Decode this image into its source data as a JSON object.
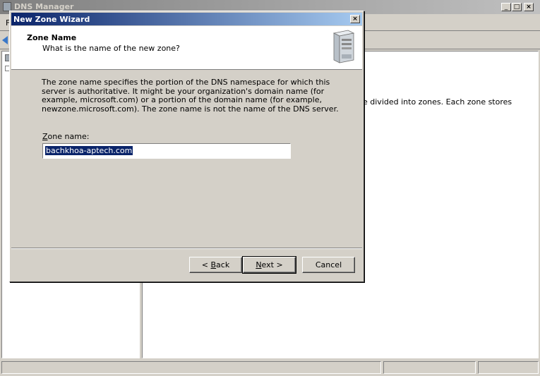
{
  "main_window": {
    "title": "DNS Manager",
    "menu_first_letter": "F",
    "right_pane_text": "e divided into zones. Each zone stores",
    "min_btn": "_",
    "max_btn": "□",
    "close_btn": "×"
  },
  "wizard": {
    "title": "New Zone Wizard",
    "close_btn": "×",
    "header_title": "Zone Name",
    "header_subtitle": "What is the name of the new zone?",
    "description": "The zone name specifies the portion of the DNS namespace for which this server is authoritative. It might be your organization's domain name (for example, microsoft.com) or a portion of the domain name (for example, newzone.microsoft.com). The zone name is not the name of the DNS server.",
    "zone_label_prefix": "Z",
    "zone_label_rest": "one name:",
    "zone_value": "bachkhoa-aptech.com",
    "back_prefix": "< ",
    "back_u": "B",
    "back_rest": "ack",
    "next_u": "N",
    "next_rest": "ext >",
    "cancel_label": "Cancel"
  },
  "colors": {
    "titlebar_active_start": "#0a246a",
    "titlebar_active_end": "#a6caf0",
    "selection": "#0a246a"
  }
}
